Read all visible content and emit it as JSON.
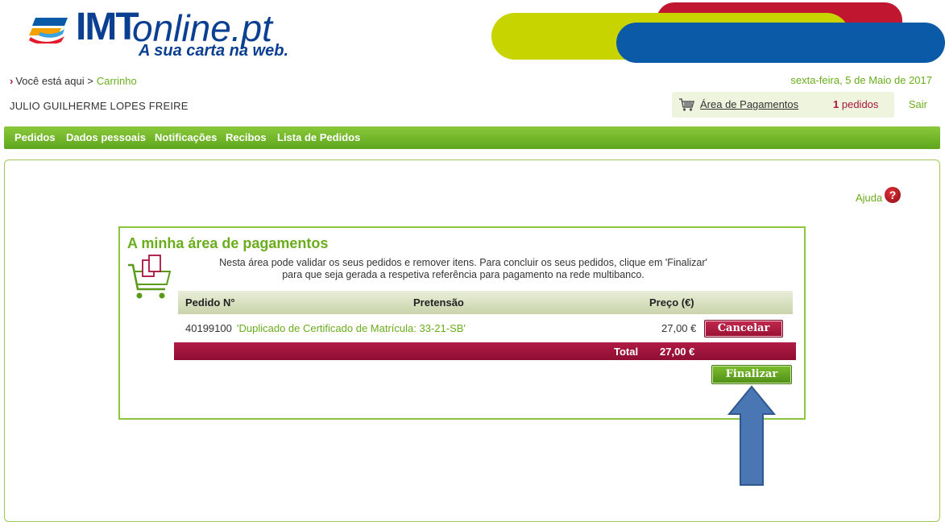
{
  "header": {
    "logo_imt": "IMT",
    "logo_online": "online.pt",
    "tagline": "A sua carta na web.",
    "logo_icon": "imt-logo-icon",
    "banner_colors": [
      "#e21a2c",
      "#c8d400",
      "#0b5aa7"
    ]
  },
  "breadcrumb": {
    "prefix": "Você está aqui >",
    "current": "Carrinho"
  },
  "date": "sexta-feira, 5 de Maio de 2017",
  "user": {
    "name": "JULIO GUILHERME LOPES FREIRE"
  },
  "payments": {
    "icon": "cart-icon",
    "link_label": "Área de Pagamentos",
    "count": "1",
    "count_label": "pedidos",
    "logout_label": "Sair"
  },
  "nav": {
    "items": [
      {
        "label": "Pedidos"
      },
      {
        "label": "Dados pessoais"
      },
      {
        "label": "Notificações"
      },
      {
        "label": "Recibos"
      },
      {
        "label": "Lista de Pedidos"
      }
    ]
  },
  "help": {
    "label": "Ajuda",
    "icon": "help-icon",
    "glyph": "?"
  },
  "card": {
    "title": "A minha área de pagamentos",
    "description_line1": "Nesta área pode validar os seus pedidos e remover itens. Para concluir os seus pedidos, clique em 'Finalizar'",
    "description_line2": "para que seja gerada a respetiva referência para pagamento na rede multibanco.",
    "icon": "shopping-cart-documents-icon",
    "table": {
      "headers": {
        "number": "Pedido N°",
        "request": "Pretensão",
        "price": "Preço (€)"
      },
      "rows": [
        {
          "number": "40199100",
          "request": "'Duplicado de Certificado de Matrícula: 33-21-SB'",
          "price": "27,00 €",
          "cancel_label": "Cancelar"
        }
      ],
      "total_label": "Total",
      "total_value": "27,00 €"
    },
    "finalize_label": "Finalizar"
  },
  "colors": {
    "brand_green": "#6aad1c",
    "brand_red": "#a8133f",
    "brand_blue": "#0b3f91",
    "annotation_arrow": "#4a77b4"
  }
}
